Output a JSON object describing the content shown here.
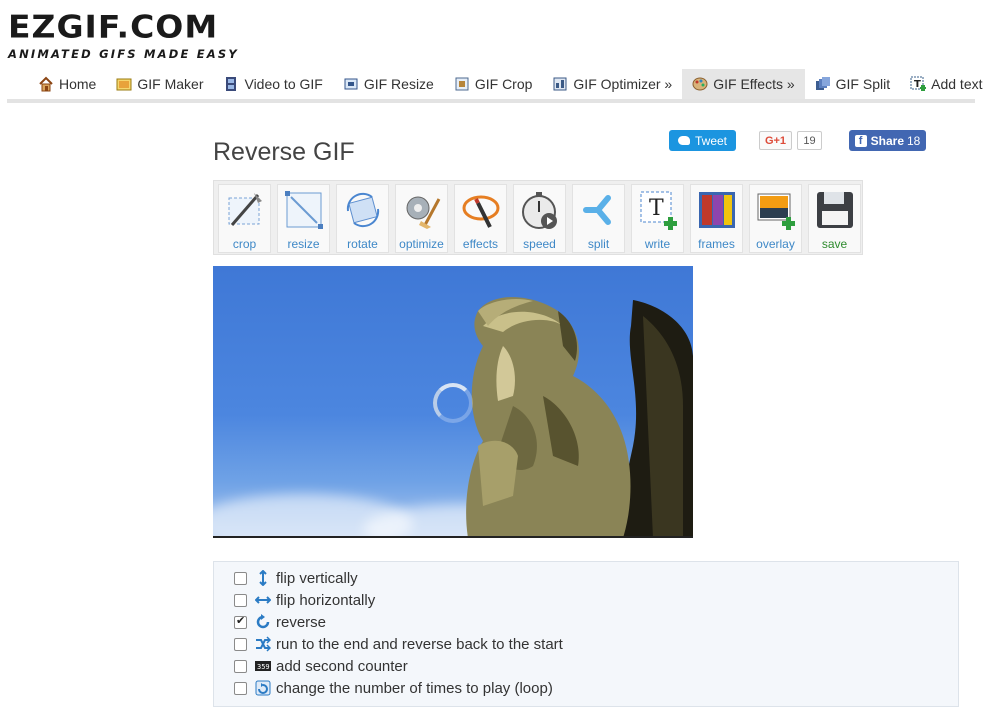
{
  "logo": {
    "main": "EZGIF.COM",
    "tagline": "ANIMATED GIFS MADE EASY"
  },
  "nav": [
    {
      "label": "Home",
      "icon": "house-icon"
    },
    {
      "label": "GIF Maker",
      "icon": "gif-maker-icon"
    },
    {
      "label": "Video to GIF",
      "icon": "film-icon"
    },
    {
      "label": "GIF Resize",
      "icon": "resize-icon"
    },
    {
      "label": "GIF Crop",
      "icon": "crop-icon"
    },
    {
      "label": "GIF Optimizer »",
      "icon": "optimizer-icon"
    },
    {
      "label": "GIF Effects »",
      "icon": "palette-icon",
      "active": true
    },
    {
      "label": "GIF Split",
      "icon": "split-icon"
    },
    {
      "label": "Add text",
      "icon": "add-text-icon"
    }
  ],
  "page": {
    "title": "Reverse GIF"
  },
  "social": {
    "tweet": "Tweet",
    "gplus": "G+1",
    "gplus_count": "19",
    "fb_share": "Share",
    "fb_count": "18"
  },
  "toolbar": [
    {
      "label": "crop",
      "icon": "crop-tool-icon"
    },
    {
      "label": "resize",
      "icon": "resize-tool-icon"
    },
    {
      "label": "rotate",
      "icon": "rotate-tool-icon"
    },
    {
      "label": "optimize",
      "icon": "optimize-tool-icon"
    },
    {
      "label": "effects",
      "icon": "effects-tool-icon"
    },
    {
      "label": "speed",
      "icon": "stopwatch-icon"
    },
    {
      "label": "split",
      "icon": "split-tool-icon"
    },
    {
      "label": "write",
      "icon": "write-tool-icon"
    },
    {
      "label": "frames",
      "icon": "frames-tool-icon"
    },
    {
      "label": "overlay",
      "icon": "overlay-tool-icon"
    },
    {
      "label": "save",
      "icon": "floppy-disk-icon"
    }
  ],
  "options": [
    {
      "label": "flip vertically",
      "checked": false,
      "icon": "vertical-arrows-icon"
    },
    {
      "label": "flip horizontally",
      "checked": false,
      "icon": "horizontal-arrows-icon"
    },
    {
      "label": "reverse",
      "checked": true,
      "icon": "reverse-icon"
    },
    {
      "label": "run to the end and reverse back to the start",
      "checked": false,
      "icon": "shuffle-icon"
    },
    {
      "label": "add second counter",
      "checked": false,
      "icon": "counter-icon"
    },
    {
      "label": "change the number of times to play (loop)",
      "checked": false,
      "icon": "loop-icon"
    }
  ]
}
